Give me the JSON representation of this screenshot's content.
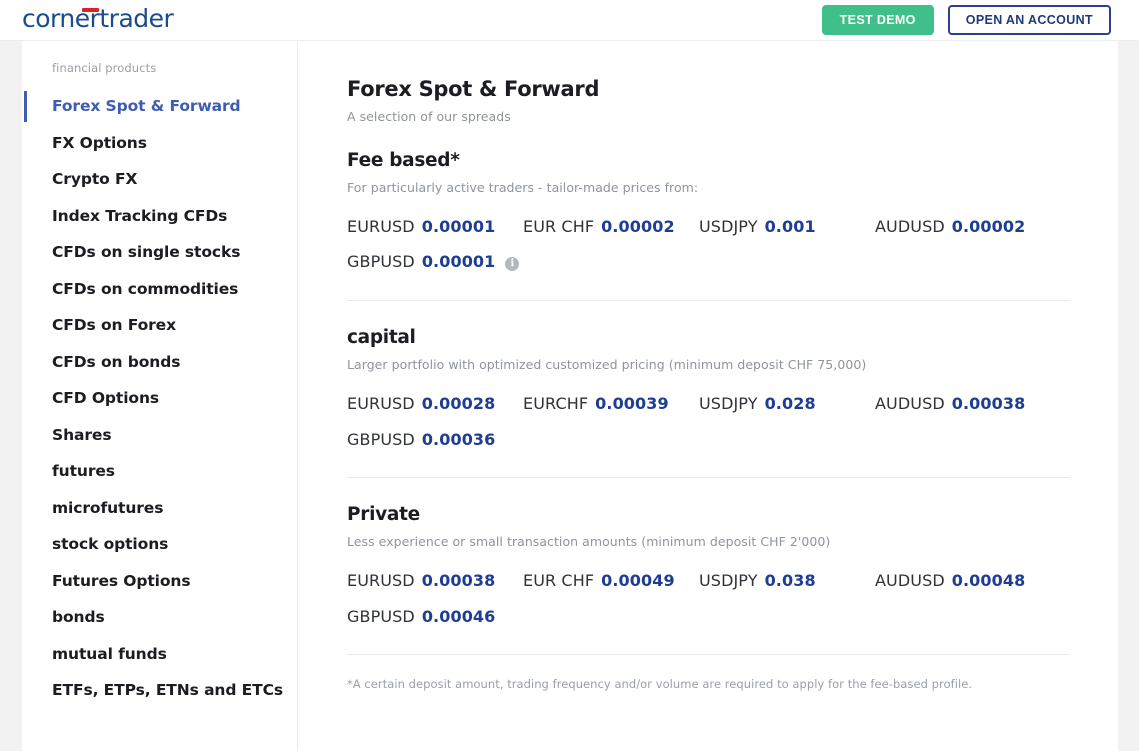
{
  "header": {
    "logo_text": "cornertrader",
    "logo_accent_color": "#d8232a",
    "logo_color": "#1b4b8f",
    "test_demo_label": "TEST DEMO",
    "test_demo_color": "#3fc08a",
    "open_account_label": "OPEN AN ACCOUNT",
    "open_account_color": "#2a3f8f"
  },
  "sidebar": {
    "label": "financial products",
    "active_color": "#3f5cb0",
    "items": [
      {
        "label": "Forex Spot & Forward",
        "active": true
      },
      {
        "label": "FX Options",
        "active": false
      },
      {
        "label": "Crypto FX",
        "active": false
      },
      {
        "label": "Index Tracking CFDs",
        "active": false
      },
      {
        "label": "CFDs on single stocks",
        "active": false
      },
      {
        "label": "CFDs on commodities",
        "active": false
      },
      {
        "label": "CFDs on Forex",
        "active": false
      },
      {
        "label": "CFDs on bonds",
        "active": false
      },
      {
        "label": "CFD Options",
        "active": false
      },
      {
        "label": "Shares",
        "active": false
      },
      {
        "label": "futures",
        "active": false
      },
      {
        "label": "microfutures",
        "active": false
      },
      {
        "label": "stock options",
        "active": false
      },
      {
        "label": "Futures Options",
        "active": false
      },
      {
        "label": "bonds",
        "active": false
      },
      {
        "label": "mutual funds",
        "active": false
      },
      {
        "label": "ETFs, ETPs, ETNs and ETCs",
        "active": false
      }
    ]
  },
  "main": {
    "title": "Forex Spot & Forward",
    "subtitle": "A selection of our spreads",
    "value_color": "#1e3e93",
    "footnote": "*A certain deposit amount, trading frequency and/or volume are required to apply for the fee-based profile.",
    "sections": [
      {
        "title": "Fee based*",
        "description": "For particularly active traders - tailor-made prices from:",
        "rows": [
          [
            {
              "pair": "EURUSD",
              "value": "0.00001"
            },
            {
              "pair": "EUR CHF",
              "value": "0.00002"
            },
            {
              "pair": "USDJPY",
              "value": "0.001"
            },
            {
              "pair": "AUDUSD",
              "value": "0.00002"
            }
          ],
          [
            {
              "pair": "GBPUSD",
              "value": "0.00001",
              "info": "i"
            }
          ]
        ]
      },
      {
        "title": "capital",
        "description": "Larger portfolio with optimized customized pricing (minimum deposit CHF 75,000)",
        "rows": [
          [
            {
              "pair": "EURUSD",
              "value": "0.00028"
            },
            {
              "pair": "EURCHF",
              "value": "0.00039"
            },
            {
              "pair": "USDJPY",
              "value": "0.028"
            },
            {
              "pair": "AUDUSD",
              "value": "0.00038"
            }
          ],
          [
            {
              "pair": "GBPUSD",
              "value": "0.00036"
            }
          ]
        ]
      },
      {
        "title": "Private",
        "description": "Less experience or small transaction amounts (minimum deposit CHF 2'000)",
        "rows": [
          [
            {
              "pair": "EURUSD",
              "value": "0.00038"
            },
            {
              "pair": "EUR CHF",
              "value": "0.00049"
            },
            {
              "pair": "USDJPY",
              "value": "0.038"
            },
            {
              "pair": "AUDUSD",
              "value": "0.00048"
            }
          ],
          [
            {
              "pair": "GBPUSD",
              "value": "0.00046"
            }
          ]
        ]
      }
    ]
  }
}
